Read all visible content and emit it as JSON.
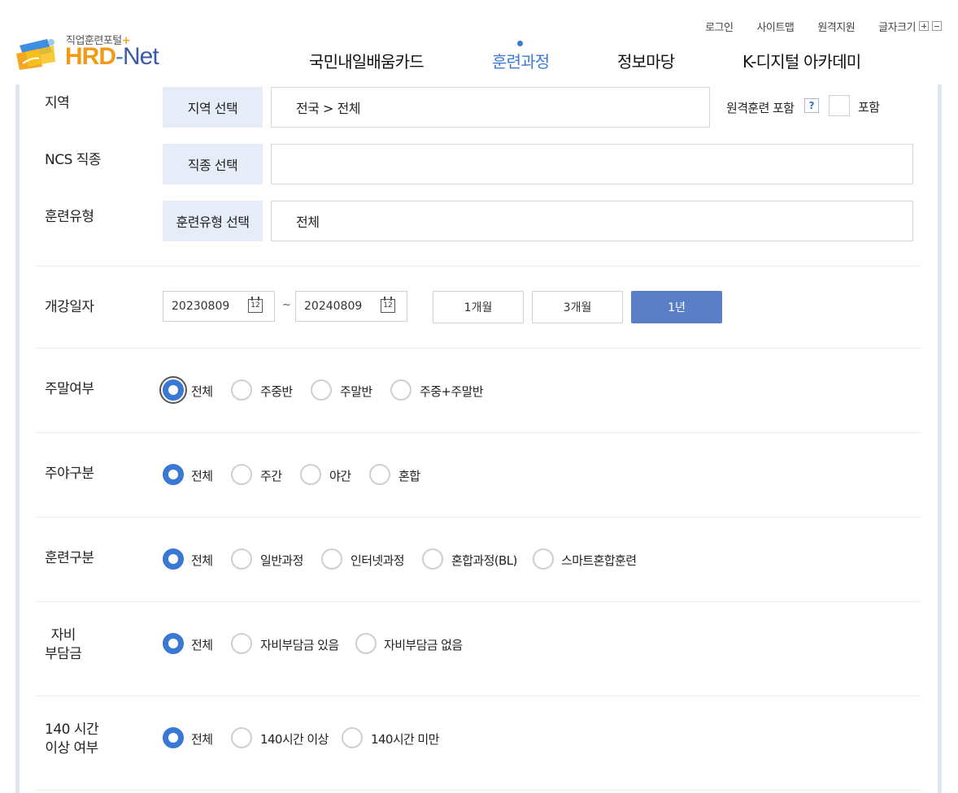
{
  "header": {
    "utility": [
      "로그인",
      "사이트맵",
      "원격지원"
    ],
    "font_size_label": "글자크기",
    "logo_sub": "직업훈련포털",
    "logo_main": "HRD",
    "logo_dash": "-",
    "logo_net": "Net",
    "nav": [
      "국민내일배움카드",
      "훈련과정",
      "정보마당",
      "K-디지털 아카데미"
    ]
  },
  "filters": {
    "region": {
      "label": "지역",
      "button": "지역 선택",
      "value": "전국 > 전체",
      "remote_label": "원격훈련 포함",
      "help": "?",
      "include_label": "포함"
    },
    "ncs": {
      "label": "NCS 직종",
      "button": "직종 선택",
      "value": ""
    },
    "type": {
      "label": "훈련유형",
      "button": "훈련유형 선택",
      "value": "전체"
    },
    "date": {
      "label": "개강일자",
      "start": "20230809",
      "end": "20240809",
      "sep": "~",
      "cal_num": "12",
      "periods": [
        "1개월",
        "3개월",
        "1년"
      ],
      "active_period": "1년"
    },
    "weekend": {
      "label": "주말여부",
      "options": [
        "전체",
        "주중반",
        "주말반",
        "주중+주말반"
      ],
      "selected": "전체"
    },
    "daynight": {
      "label": "주야구분",
      "options": [
        "전체",
        "주간",
        "야간",
        "혼합"
      ],
      "selected": "전체"
    },
    "training": {
      "label": "훈련구분",
      "options": [
        "전체",
        "일반과정",
        "인터넷과정",
        "혼합과정(BL)",
        "스마트혼합훈련"
      ],
      "selected": "전체"
    },
    "selfpay": {
      "label_line1": "자비",
      "label_line2": "부담금",
      "options": [
        "전체",
        "자비부담금 있음",
        "자비부담금 없음"
      ],
      "selected": "전체"
    },
    "hours": {
      "label_line1": "140 시간",
      "label_line2": "이상 여부",
      "options": [
        "전체",
        "140시간 이상",
        "140시간 미만"
      ],
      "selected": "전체"
    }
  },
  "colors": {
    "accent": "#3a78d6",
    "active_button": "#5b7fc6",
    "select_bg": "#e6edf8"
  }
}
